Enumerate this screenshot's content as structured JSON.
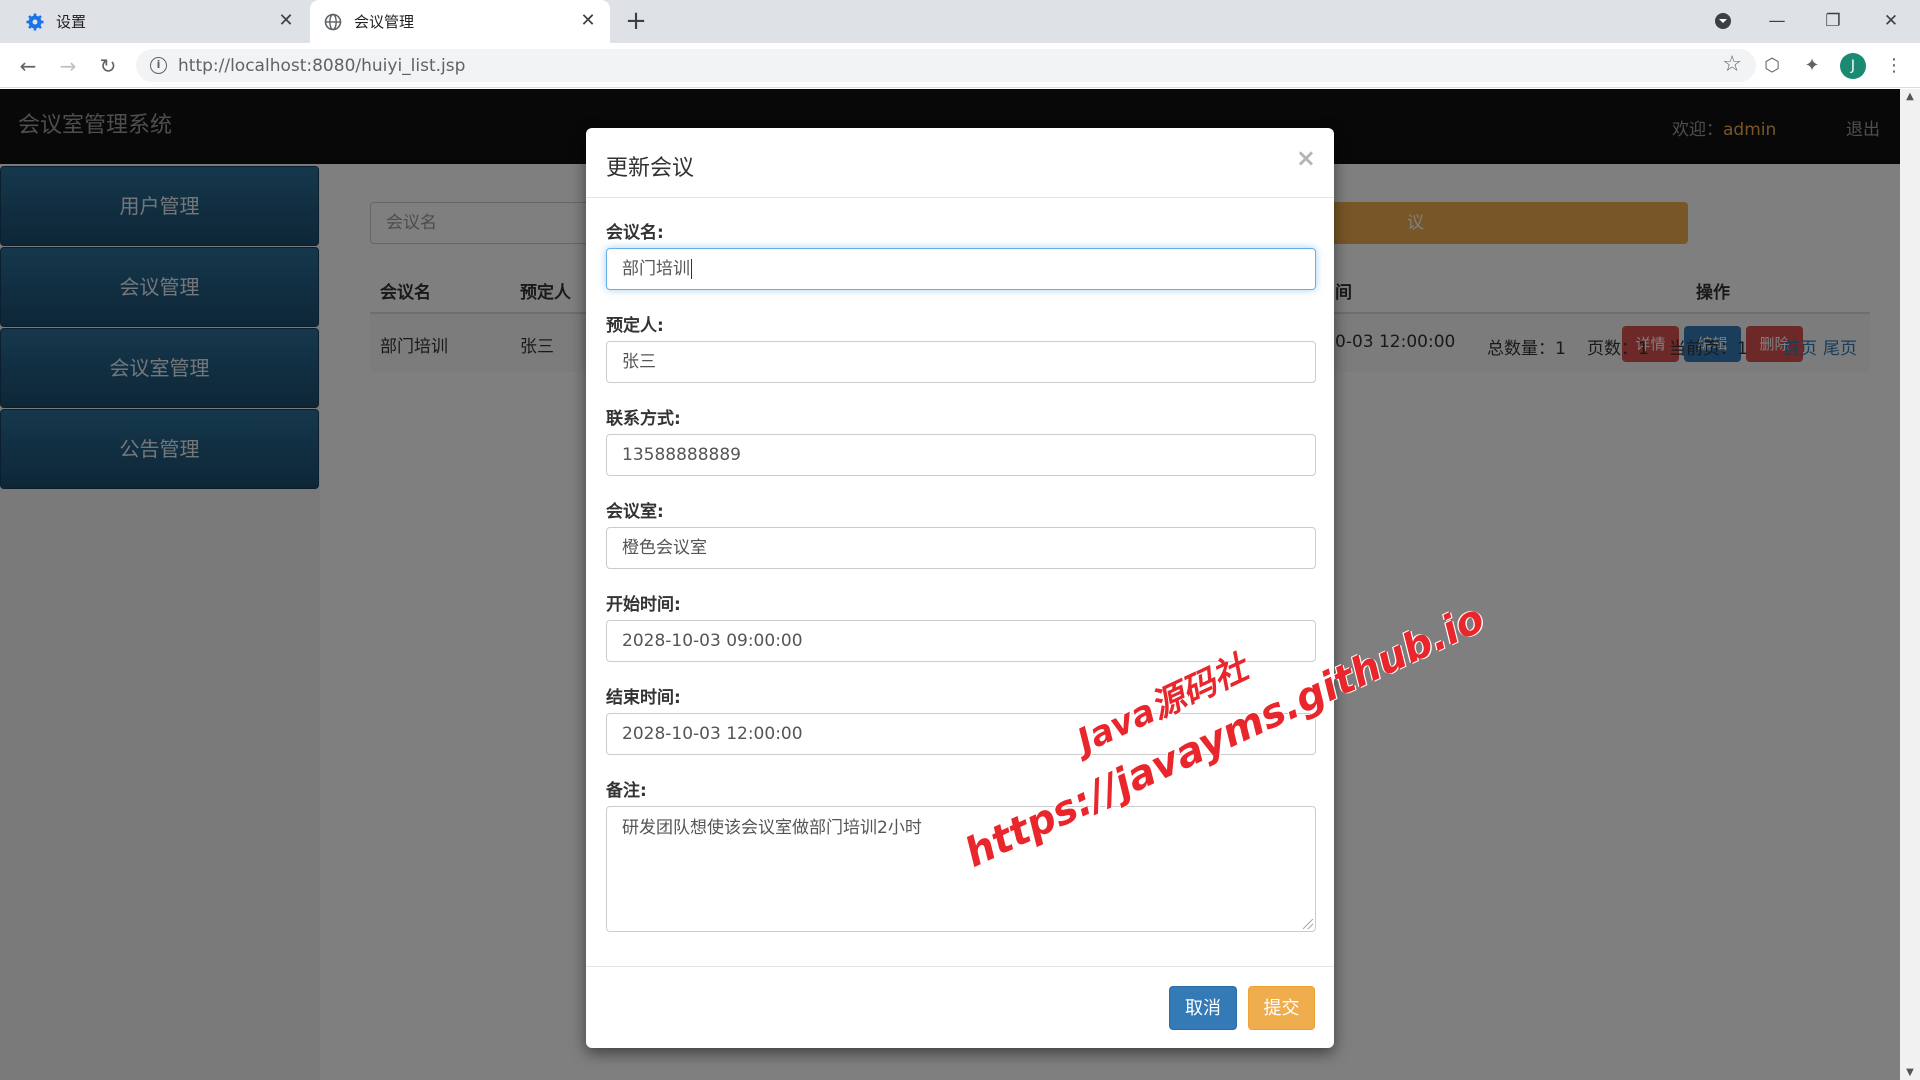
{
  "browser": {
    "tabs": [
      {
        "label": "设置",
        "icon": "gear-icon"
      },
      {
        "label": "会议管理",
        "icon": "globe-icon"
      }
    ],
    "url": "http://localhost:8080/huiyi_list.jsp",
    "profile_initial": "J"
  },
  "navbar": {
    "brand": "会议室管理系统",
    "welcome_label": "欢迎：",
    "username": "admin",
    "logout": "退出"
  },
  "sidebar": {
    "items": [
      {
        "label": "用户管理"
      },
      {
        "label": "会议管理"
      },
      {
        "label": "会议室管理"
      },
      {
        "label": "公告管理"
      }
    ]
  },
  "content": {
    "search_placeholder": "会议名",
    "add_button": "议",
    "table": {
      "headers": [
        "会议名",
        "预定人",
        "间",
        "操作"
      ],
      "rows": [
        {
          "name": "部门培训",
          "booker": "张三",
          "end_time_partial": "0-03 12:00:00"
        }
      ],
      "actions": {
        "detail": "详情",
        "edit": "编辑",
        "delete": "删除"
      }
    },
    "pager": {
      "total": "总数量：1",
      "pages": "页数：1",
      "current": "当前页：1",
      "first": "首页",
      "last": "尾页"
    }
  },
  "modal": {
    "title": "更新会议",
    "close": "×",
    "fields": {
      "name": {
        "label": "会议名:",
        "value": "部门培训"
      },
      "booker": {
        "label": "预定人:",
        "value": "张三"
      },
      "contact": {
        "label": "联系方式:",
        "value": "13588888889"
      },
      "room": {
        "label": "会议室:",
        "value": "橙色会议室"
      },
      "start": {
        "label": "开始时间:",
        "value": "2028-10-03 09:00:00"
      },
      "end": {
        "label": "结束时间:",
        "value": "2028-10-03 12:00:00"
      },
      "remark": {
        "label": "备注:",
        "value": "研发团队想使该会议室做部门培训2小时"
      }
    },
    "cancel": "取消",
    "submit": "提交"
  },
  "watermark": {
    "line1": "Java源码社",
    "line2": "https://javayms.github.io"
  },
  "colors": {
    "primary": "#337ab7",
    "warning": "#f0ad4e",
    "danger": "#d9534f",
    "navbar": "#111111",
    "sidebar": "#1f5a80"
  }
}
